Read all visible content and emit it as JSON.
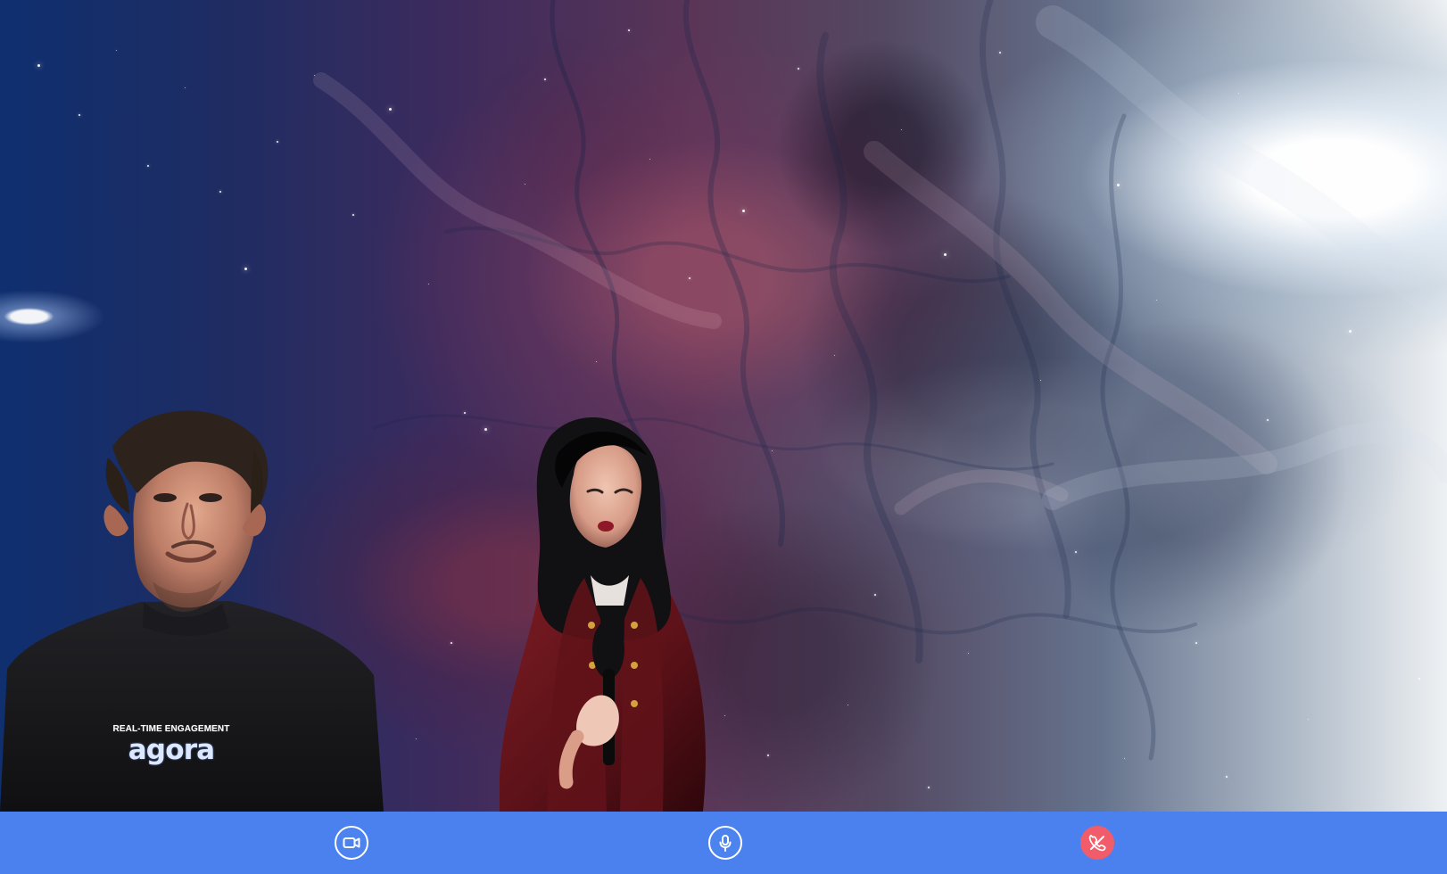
{
  "stage": {
    "background": "space nebula video background",
    "colors": {
      "deep_blue": "#0f2f6f",
      "purple": "#5a3557",
      "pale_light": "#eef1f3"
    }
  },
  "participants": [
    {
      "shirt_text_small": "REAL-TIME ENGAGEMENT",
      "shirt_text_large": "agora"
    },
    {}
  ],
  "control_bar": {
    "background": "#4a81ef",
    "buttons": [
      {
        "icon": "camera-icon",
        "color": "#ffffff"
      },
      {
        "icon": "microphone-icon",
        "color": "#ffffff"
      },
      {
        "icon": "hang-up-icon",
        "color": "#f05c6a"
      }
    ]
  }
}
